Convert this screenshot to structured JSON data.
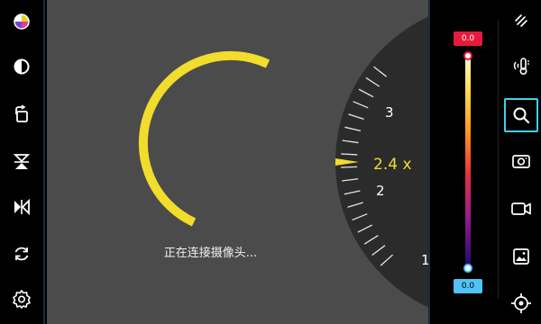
{
  "viewport": {
    "status_text": "正在连接摄像头...",
    "zoom": {
      "current_label": "2.4 x",
      "current_value": 2.4,
      "tick_labels": [
        "3",
        "2",
        "1"
      ]
    }
  },
  "temperature_scale": {
    "max_label": "0.0",
    "min_label": "0.0",
    "max_color": "#e8193c",
    "min_color": "#4fc3f7"
  },
  "left_toolbar": {
    "icons": [
      "palette-icon",
      "contrast-icon",
      "rotate-icon",
      "mirror-vertical-icon",
      "mirror-horizontal-icon",
      "refresh-icon",
      "settings-icon"
    ]
  },
  "right_toolbar": {
    "icons": [
      "draw-icon",
      "thermometer-icon",
      "search-icon",
      "photo-icon",
      "video-icon",
      "gallery-icon",
      "target-icon"
    ],
    "active": "search-icon"
  },
  "colors": {
    "accent_yellow": "#f2dc2c",
    "viewport_bg": "#4b4b4b",
    "active_cyan": "#3fd0e6"
  }
}
